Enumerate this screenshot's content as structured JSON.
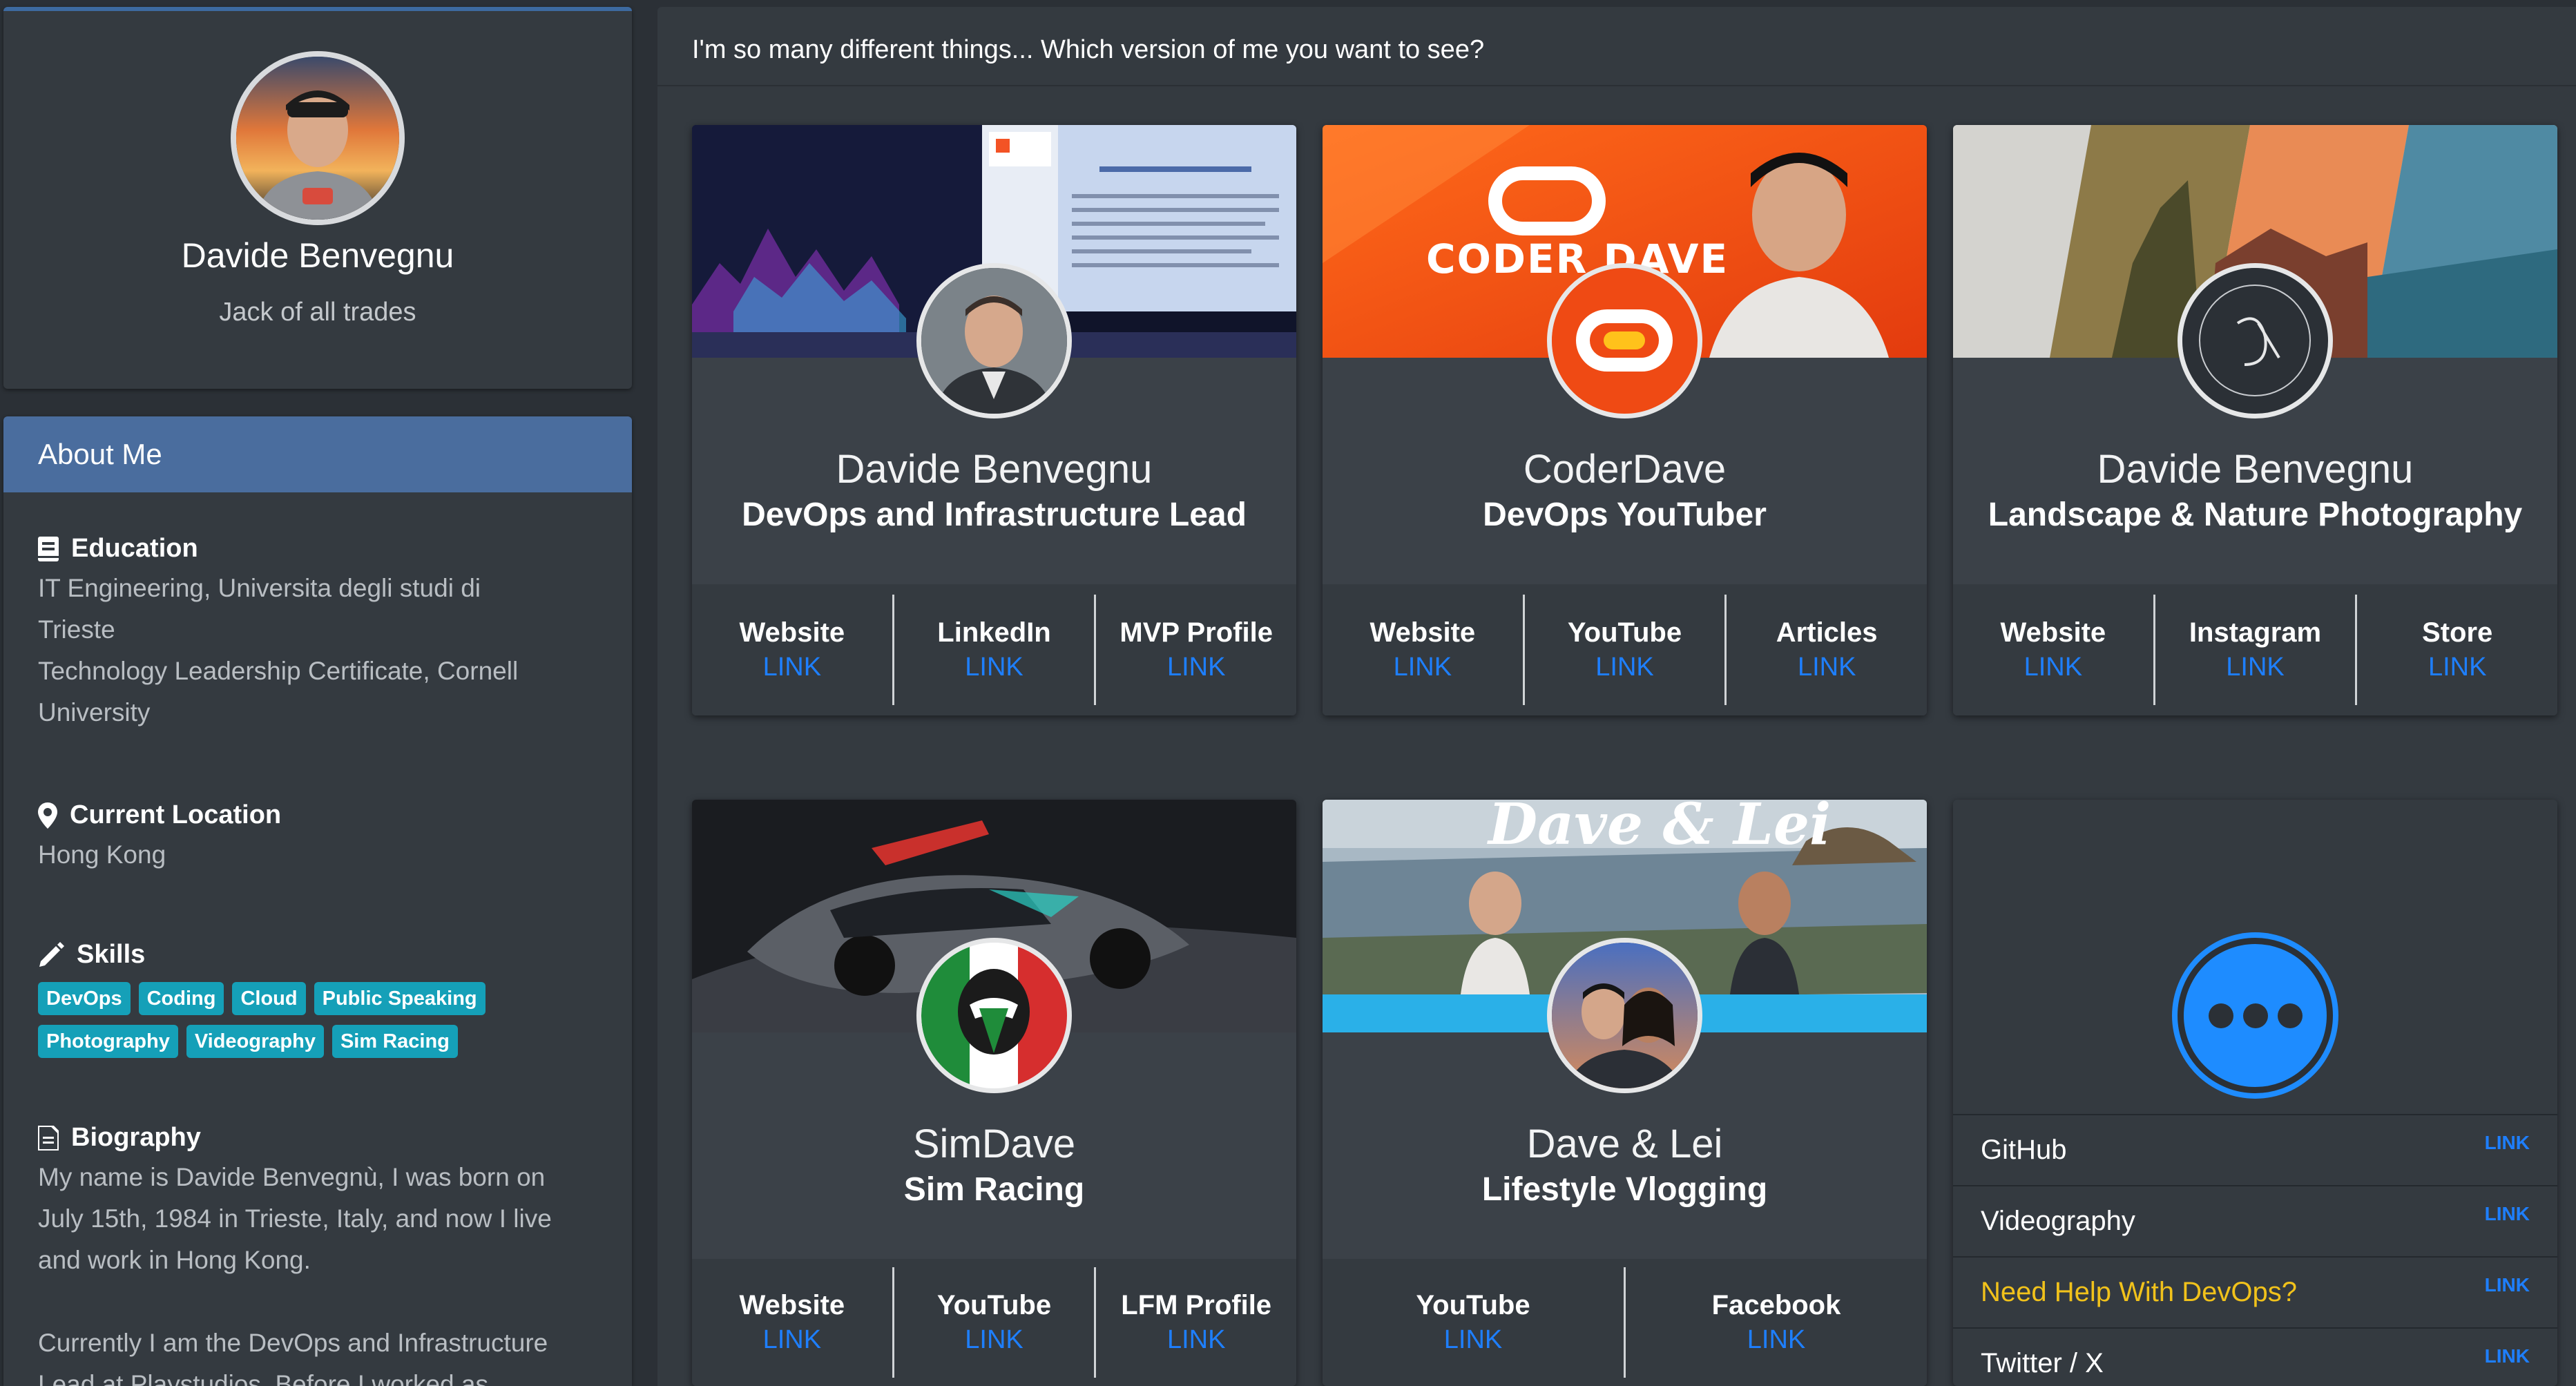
{
  "profile": {
    "name": "Davide Benvegnu",
    "tagline": "Jack of all trades"
  },
  "about": {
    "header": "About Me",
    "education": {
      "title": "Education",
      "lines": [
        "IT Engineering, Universita degli studi di",
        "Trieste",
        "Technology Leadership Certificate, Cornell",
        "University"
      ]
    },
    "location": {
      "title": "Current Location",
      "value": "Hong Kong"
    },
    "skills": {
      "title": "Skills",
      "items": [
        "DevOps",
        "Coding",
        "Cloud",
        "Public Speaking",
        "Photography",
        "Videography",
        "Sim Racing"
      ]
    },
    "biography": {
      "title": "Biography",
      "paragraphs": [
        "My name is Davide Benvegnù, I was born on July 15th, 1984 in Trieste, Italy, and now I live and work in Hong Kong.",
        "Currently I am the DevOps and Infrastructure Lead at Playstudios. Before I worked as"
      ]
    }
  },
  "main": {
    "header": "I'm so many different things... Which version of me you want to see?",
    "cards": [
      {
        "name": "Davide Benvegnu",
        "role": "DevOps and Infrastructure Lead",
        "links": [
          {
            "label": "Website",
            "link": "LINK"
          },
          {
            "label": "LinkedIn",
            "link": "LINK"
          },
          {
            "label": "MVP Profile",
            "link": "LINK"
          }
        ]
      },
      {
        "name": "CoderDave",
        "role": "DevOps YouTuber",
        "banner_text": "CODER DAVE",
        "links": [
          {
            "label": "Website",
            "link": "LINK"
          },
          {
            "label": "YouTube",
            "link": "LINK"
          },
          {
            "label": "Articles",
            "link": "LINK"
          }
        ]
      },
      {
        "name": "Davide Benvegnu",
        "role": "Landscape & Nature Photography",
        "links": [
          {
            "label": "Website",
            "link": "LINK"
          },
          {
            "label": "Instagram",
            "link": "LINK"
          },
          {
            "label": "Store",
            "link": "LINK"
          }
        ]
      },
      {
        "name": "SimDave",
        "role": "Sim Racing",
        "links": [
          {
            "label": "Website",
            "link": "LINK"
          },
          {
            "label": "YouTube",
            "link": "LINK"
          },
          {
            "label": "LFM Profile",
            "link": "LINK"
          }
        ]
      },
      {
        "name": "Dave & Lei",
        "role": "Lifestyle Vlogging",
        "banner_text": "Dave & Lei",
        "links": [
          {
            "label": "YouTube",
            "link": "LINK"
          },
          {
            "label": "Facebook",
            "link": "LINK"
          }
        ]
      }
    ],
    "more": {
      "items": [
        {
          "label": "GitHub",
          "link": "LINK"
        },
        {
          "label": "Videography",
          "link": "LINK"
        },
        {
          "label": "Need Help With DevOps?",
          "link": "LINK"
        },
        {
          "label": "Twitter / X",
          "link": "LINK"
        }
      ]
    }
  },
  "colors": {
    "accent_blue": "#4a6d9e",
    "link_blue": "#1e7fff",
    "skill_badge": "#15a0b8",
    "highlight_yellow": "#f1c21b"
  }
}
